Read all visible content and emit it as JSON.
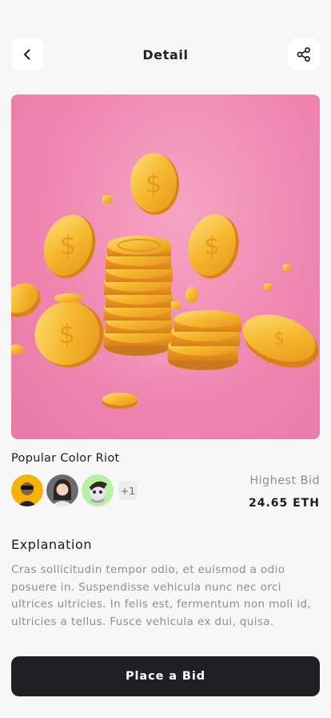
{
  "header": {
    "title": "Detail",
    "back_icon": "chevron-left-icon",
    "share_icon": "share-icon"
  },
  "item": {
    "title": "Popular Color Riot",
    "extra_owners": "+1",
    "highest_bid_label": "Highest Bid",
    "highest_bid_value": "24.65 ETH"
  },
  "explanation": {
    "title": "Explanation",
    "body": "Cras sollicitudin tempor odio, et euismod a odio posuere in. Suspendisse vehicula nunc nec orci ultrices ultricies. In felis est, fermentum non moli id, ultricies a tellus. Fusce vehicula ex dui, quisa."
  },
  "action": {
    "bid_button_label": "Place a Bid"
  },
  "colors": {
    "background": "#f7f7f7",
    "button_dark": "#202024",
    "hero_pink": "#ef86b0",
    "coin_gold": "#f5b82e",
    "muted_text": "#8e8e93"
  }
}
